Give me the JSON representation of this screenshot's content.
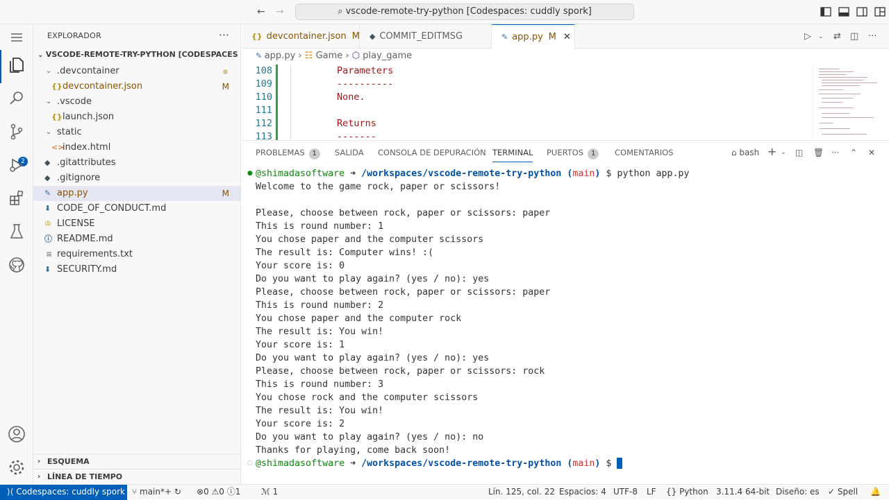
{
  "titlebar": {
    "search": "vscode-remote-try-python [Codespaces: cuddly spork]"
  },
  "activity": {
    "scm_badge": "2"
  },
  "sidebar": {
    "title": "EXPLORADOR",
    "root": "VSCODE-REMOTE-TRY-PYTHON [CODESPACES: CUD...",
    "items": [
      {
        "label": ".devcontainer",
        "badge": ""
      },
      {
        "label": "devcontainer.json",
        "badge": "M"
      },
      {
        "label": ".vscode",
        "badge": ""
      },
      {
        "label": "launch.json",
        "badge": ""
      },
      {
        "label": "static",
        "badge": ""
      },
      {
        "label": "index.html",
        "badge": ""
      },
      {
        "label": ".gitattributes",
        "badge": ""
      },
      {
        "label": ".gitignore",
        "badge": ""
      },
      {
        "label": "app.py",
        "badge": "M"
      },
      {
        "label": "CODE_OF_CONDUCT.md",
        "badge": ""
      },
      {
        "label": "LICENSE",
        "badge": ""
      },
      {
        "label": "README.md",
        "badge": ""
      },
      {
        "label": "requirements.txt",
        "badge": ""
      },
      {
        "label": "SECURITY.md",
        "badge": ""
      }
    ],
    "outline": "ESQUEMA",
    "timeline": "LÍNEA DE TIEMPO"
  },
  "tabs": [
    {
      "label": "devcontainer.json",
      "mod": "M"
    },
    {
      "label": "COMMIT_EDITMSG",
      "mod": ""
    },
    {
      "label": "app.py",
      "mod": "M"
    }
  ],
  "breadcrumb": {
    "file": "app.py",
    "cls": "Game",
    "fn": "play_game"
  },
  "code": [
    {
      "n": "108",
      "t": "Parameters"
    },
    {
      "n": "109",
      "t": "----------"
    },
    {
      "n": "110",
      "t": "None."
    },
    {
      "n": "111",
      "t": ""
    },
    {
      "n": "112",
      "t": "Returns"
    },
    {
      "n": "113",
      "t": "-------"
    }
  ],
  "panel": {
    "tabs": {
      "problems": "PROBLEMAS",
      "problems_count": "1",
      "output": "SALIDA",
      "debug": "CONSOLA DE DEPURACIÓN",
      "terminal": "TERMINAL",
      "ports": "PUERTOS",
      "ports_count": "1",
      "comments": "COMENTARIOS"
    },
    "shell": "bash"
  },
  "terminal": {
    "user": "@shimadasoftware",
    "arrow": "➜",
    "path": "/workspaces/vscode-remote-try-python",
    "branch_open": "(",
    "branch": "main",
    "branch_close": ")",
    "prompt": "$",
    "command": "python app.py",
    "lines": [
      "Welcome to the game rock, paper or scissors!",
      "",
      "Please, choose between rock, paper or scissors: paper",
      "This is round number: 1",
      "You chose paper and the computer scissors",
      "The result is: Computer wins! :(",
      "Your score is: 0",
      "Do you want to play again? (yes / no): yes",
      "Please, choose between rock, paper or scissors: paper",
      "This is round number: 2",
      "You chose paper and the computer rock",
      "The result is: You win!",
      "Your score is: 1",
      "Do you want to play again? (yes / no): yes",
      "Please, choose between rock, paper or scissors: rock",
      "This is round number: 3",
      "You chose rock and the computer scissors",
      "The result is: You win!",
      "Your score is: 2",
      "Do you want to play again? (yes / no): no",
      "Thanks for playing, come back soon!"
    ]
  },
  "status": {
    "remote": "Codespaces: cuddly spork",
    "branch": "main*+",
    "problems": "0",
    "warnings": "0",
    "info": "1",
    "ports": "1",
    "position": "Lín. 125, col. 22",
    "spaces": "Espacios: 4",
    "encoding": "UTF-8",
    "eol": "LF",
    "language": "Python",
    "interpreter": "3.11.4 64-bit",
    "layout": "Diseño: es",
    "spell": "Spell"
  }
}
